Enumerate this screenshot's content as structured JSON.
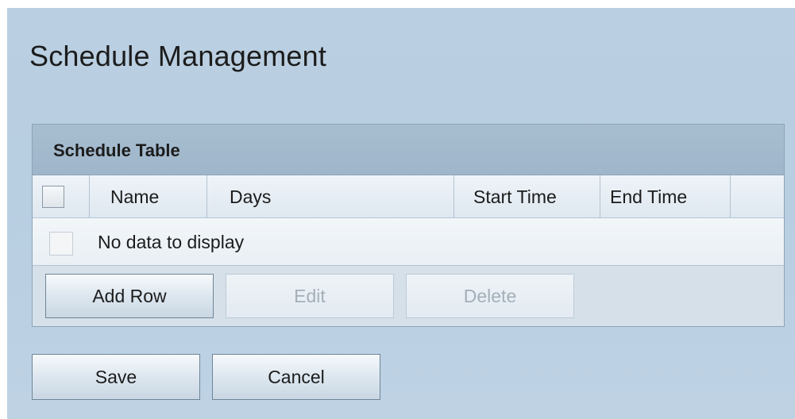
{
  "page": {
    "title": "Schedule Management"
  },
  "schedule_table": {
    "caption": "Schedule Table",
    "columns": [
      "Name",
      "Days",
      "Start Time",
      "End Time"
    ],
    "empty_message": "No data to display",
    "buttons": {
      "add_row": "Add Row",
      "edit": "Edit",
      "delete": "Delete"
    }
  },
  "footer": {
    "save": "Save",
    "cancel": "Cancel"
  }
}
